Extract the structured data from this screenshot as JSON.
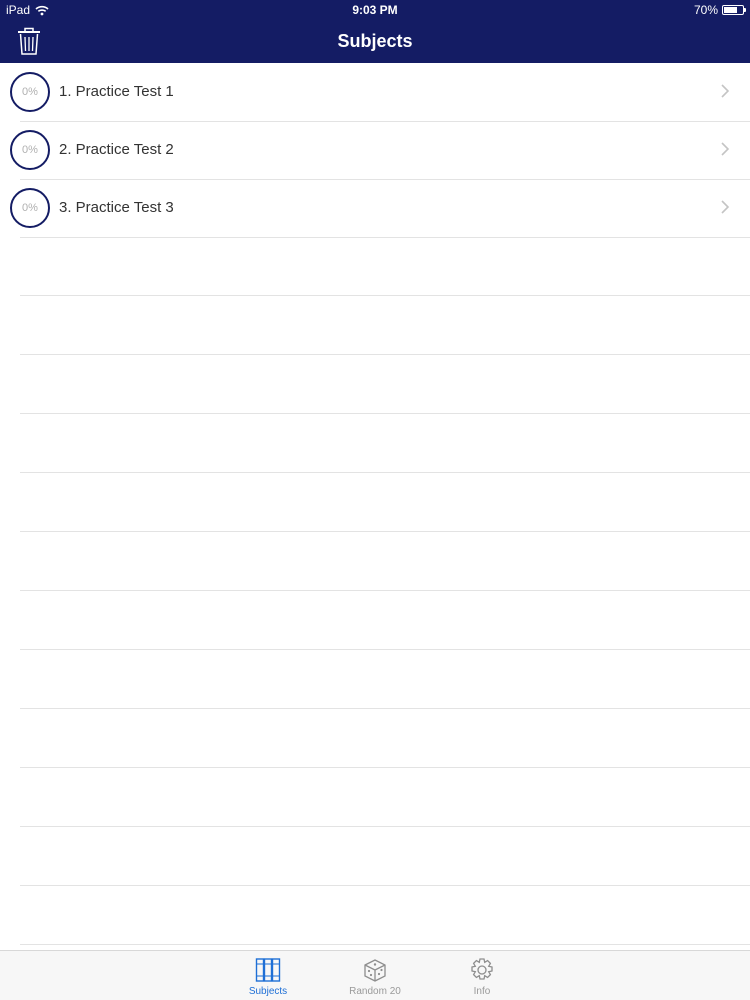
{
  "status_bar": {
    "device": "iPad",
    "time": "9:03 PM",
    "battery": "70%",
    "battery_level": 0.7
  },
  "nav": {
    "title": "Subjects",
    "delete_icon": "trash-icon"
  },
  "subjects": [
    {
      "progress": "0%",
      "title": "1. Practice Test 1"
    },
    {
      "progress": "0%",
      "title": "2. Practice Test 2"
    },
    {
      "progress": "0%",
      "title": "3. Practice Test 3"
    }
  ],
  "tabs": [
    {
      "label": "Subjects",
      "icon": "books-icon",
      "active": true
    },
    {
      "label": "Random 20",
      "icon": "dice-icon",
      "active": false
    },
    {
      "label": "Info",
      "icon": "gear-icon",
      "active": false
    }
  ],
  "colors": {
    "nav_bg": "#141c64",
    "accent": "#1e6fd6"
  }
}
